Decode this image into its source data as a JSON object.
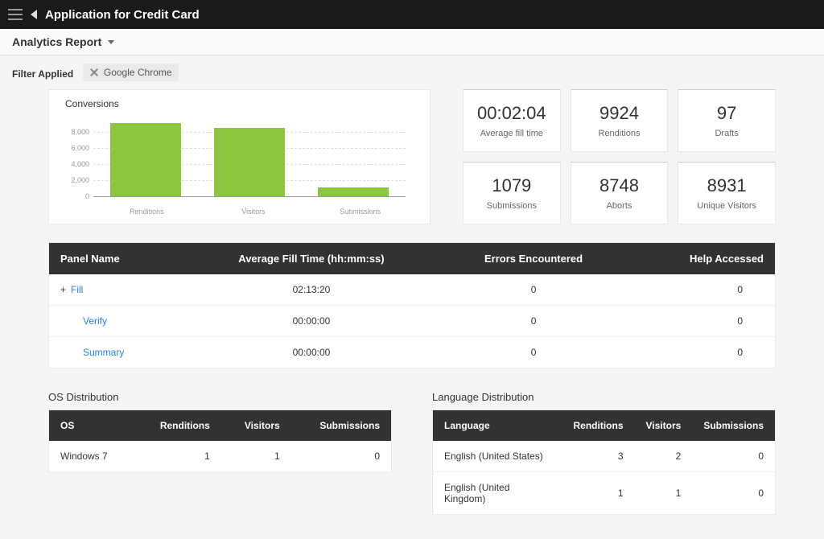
{
  "header": {
    "title": "Application for Credit Card"
  },
  "subheader": {
    "report_label": "Analytics Report"
  },
  "filter": {
    "label": "Filter Applied",
    "chip": "Google Chrome"
  },
  "conversions": {
    "title": "Conversions"
  },
  "chart_data": {
    "type": "bar",
    "categories": [
      "Renditions",
      "Visitors",
      "Submissions"
    ],
    "values": [
      9100,
      8500,
      1100
    ],
    "yticks": [
      0,
      2000,
      4000,
      6000,
      8000
    ],
    "ytick_labels": [
      "0",
      "2,000",
      "4,000",
      "6,000",
      "8,000"
    ],
    "ylim": [
      0,
      10000
    ]
  },
  "metrics": [
    {
      "value": "00:02:04",
      "label": "Average fill time"
    },
    {
      "value": "9924",
      "label": "Renditions"
    },
    {
      "value": "97",
      "label": "Drafts"
    },
    {
      "value": "1079",
      "label": "Submissions"
    },
    {
      "value": "8748",
      "label": "Aborts"
    },
    {
      "value": "8931",
      "label": "Unique Visitors"
    }
  ],
  "panel": {
    "headers": [
      "Panel Name",
      "Average Fill Time (hh:mm:ss)",
      "Errors Encountered",
      "Help Accessed"
    ],
    "rows": [
      {
        "expand": "+",
        "name": "Fill",
        "time": "02:13:20",
        "errors": "0",
        "help": "0"
      },
      {
        "expand": "",
        "name": "Verify",
        "time": "00:00:00",
        "errors": "0",
        "help": "0"
      },
      {
        "expand": "",
        "name": "Summary",
        "time": "00:00:00",
        "errors": "0",
        "help": "0"
      }
    ]
  },
  "os": {
    "title": "OS Distribution",
    "headers": [
      "OS",
      "Renditions",
      "Visitors",
      "Submissions"
    ],
    "rows": [
      {
        "name": "Windows 7",
        "r": "1",
        "v": "1",
        "s": "0"
      }
    ]
  },
  "lang": {
    "title": "Language Distribution",
    "headers": [
      "Language",
      "Renditions",
      "Visitors",
      "Submissions"
    ],
    "rows": [
      {
        "name": "English (United States)",
        "r": "3",
        "v": "2",
        "s": "0"
      },
      {
        "name": "English (United Kingdom)",
        "r": "1",
        "v": "1",
        "s": "0"
      }
    ]
  },
  "colors": {
    "bar": "#8cc63f"
  }
}
